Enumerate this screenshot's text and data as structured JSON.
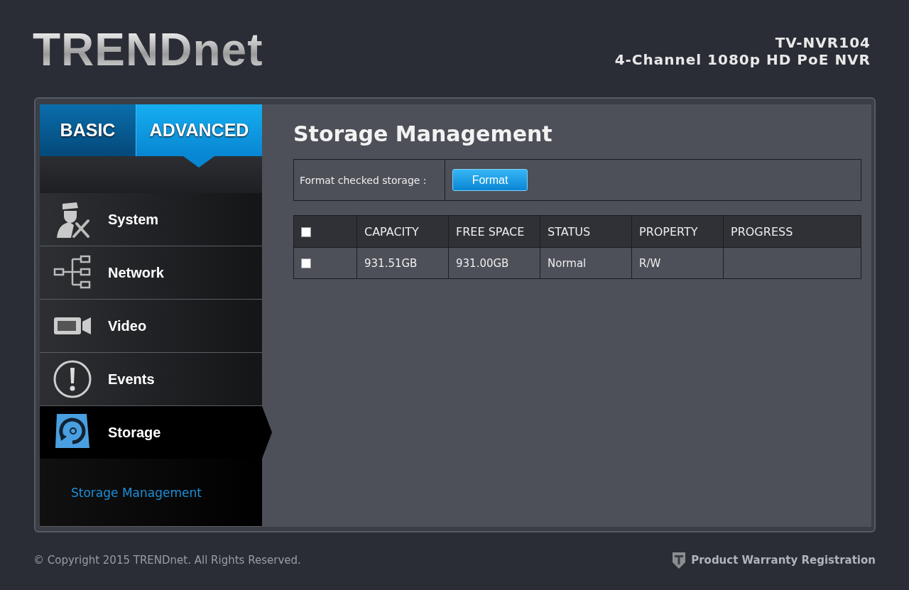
{
  "header": {
    "logo": "TRENDnet",
    "model": "TV-NVR104",
    "description": "4-Channel 1080p HD PoE NVR"
  },
  "tabs": [
    {
      "label": "BASIC",
      "selected": false
    },
    {
      "label": "ADVANCED",
      "selected": true
    }
  ],
  "menu": [
    {
      "label": "System",
      "selected": false
    },
    {
      "label": "Network",
      "selected": false
    },
    {
      "label": "Video",
      "selected": false
    },
    {
      "label": "Events",
      "selected": false
    },
    {
      "label": "Storage",
      "selected": true,
      "children": [
        {
          "label": "Storage Management",
          "selected": true
        }
      ]
    }
  ],
  "page": {
    "title": "Storage Management",
    "format_label": "Format checked storage :",
    "format_button": "Format"
  },
  "table": {
    "select_all_checked": false,
    "columns": [
      "CAPACITY",
      "FREE SPACE",
      "STATUS",
      "PROPERTY",
      "PROGRESS"
    ],
    "rows": [
      {
        "checked": false,
        "cells": [
          "931.51GB",
          "931.00GB",
          "Normal",
          "R/W"
        ]
      }
    ]
  },
  "footer": {
    "copyright": "© Copyright 2015 TRENDnet. All Rights Reserved.",
    "warranty_link": "Product Warranty Registration"
  }
}
